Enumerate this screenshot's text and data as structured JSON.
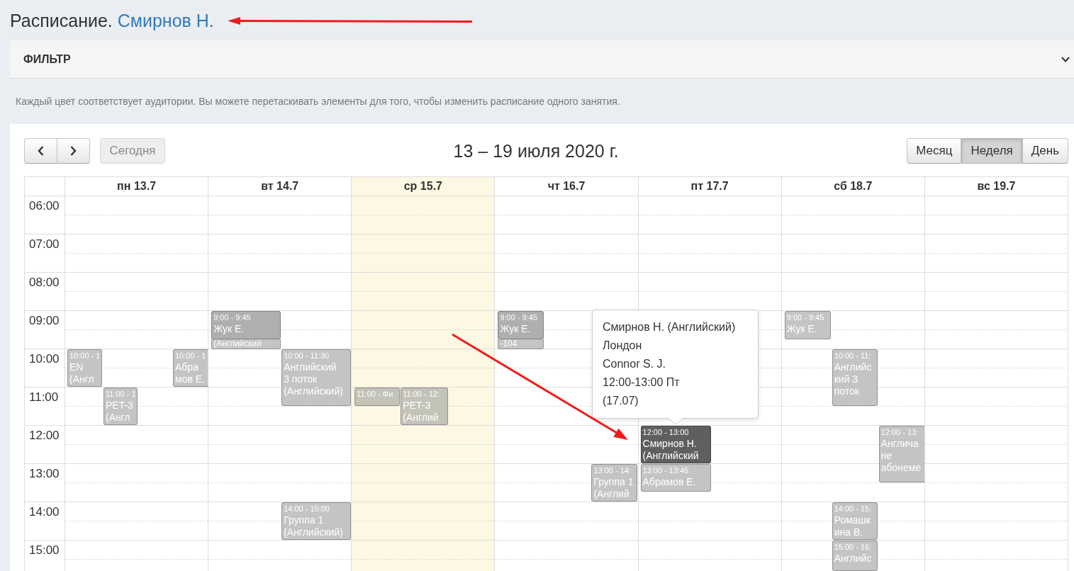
{
  "page": {
    "title": "Расписание.",
    "person": "Смирнов Н."
  },
  "filter": {
    "label": "ФИЛЬТР",
    "expanded": false
  },
  "hint": "Каждый цвет соответствует аудитории. Вы можете перетаскивать элементы для того, чтобы изменить расписание одного занятия.",
  "calendar": {
    "today_button": {
      "label": "Сегодня",
      "disabled": true
    },
    "title": "13 – 19 июля 2020 г.",
    "views": [
      {
        "label": "Месяц",
        "selected": false
      },
      {
        "label": "Неделя",
        "selected": true
      },
      {
        "label": "День",
        "selected": false
      }
    ],
    "days": [
      {
        "label": "пн 13.7",
        "today": false,
        "events": [
          {
            "time": "10:00 - 1",
            "lines": [
              "EN",
              "(Англ"
            ],
            "color": "#c4c4c4"
          },
          {
            "time": "11:00 - 1",
            "lines": [
              "PET-3",
              "(Англ"
            ],
            "color": "#c4c4c4"
          },
          {
            "time": "10:00 - 1",
            "lines": [
              "Абра",
              "мов Е."
            ],
            "color": "#c4c4c4"
          }
        ]
      },
      {
        "label": "вт 14.7",
        "today": false,
        "events": [
          {
            "time": "9:00 - 9:45",
            "lines": [
              "Жук Е."
            ],
            "color": "#afafaf"
          },
          {
            "lines": [
              "(Английский"
            ],
            "color": "#c4c4c4"
          },
          {
            "time": "10:00 - 11:30",
            "lines": [
              "Английский",
              "3 поток",
              "(Английский)"
            ],
            "color": "#c4c4c4"
          },
          {
            "time": "14:00 - 15:00",
            "lines": [
              "Группа 1",
              "(Английский)"
            ],
            "color": "#c4c4c4"
          }
        ]
      },
      {
        "label": "ср 15.7",
        "today": true,
        "events": [
          {
            "time": "11:00 - Фи",
            "color": "#c4c3b8"
          },
          {
            "time": "11:00 - 12:",
            "lines": [
              "PET-3",
              "(Англий"
            ],
            "color": "#c4c3b8"
          }
        ]
      },
      {
        "label": "чт 16.7",
        "today": false,
        "events": [
          {
            "time": "9:00 - 9:45",
            "lines": [
              "Жук Е."
            ],
            "color": "#afafaf"
          },
          {
            "lines": [
              "-104"
            ],
            "color": "#c4c4c4"
          },
          {
            "time": "13:00 - 14:",
            "lines": [
              "Группа 1",
              "(Англий"
            ],
            "color": "#c4c4c4"
          }
        ]
      },
      {
        "label": "пт 17.7",
        "today": false,
        "events": [
          {
            "time": "12:00 - 13:00",
            "lines": [
              "Смирнов Н.",
              "(Английский"
            ],
            "color": "#5f5f5f"
          },
          {
            "time": "13:00 - 13:45",
            "lines": [
              "Абрамов Е."
            ],
            "color": "#c4c4c4"
          }
        ]
      },
      {
        "label": "сб 18.7",
        "today": false,
        "events": [
          {
            "time": "9:00 - 9:45",
            "lines": [
              "Жук Е."
            ],
            "color": "#c4c4c4"
          },
          {
            "time": "10:00 - 11:",
            "lines": [
              "Английс",
              "кий 3",
              "поток"
            ],
            "color": "#c4c4c4"
          },
          {
            "time": "12:00 - 13:",
            "lines": [
              "Англича",
              "не",
              "абонеме"
            ],
            "color": "#c4c4c4"
          },
          {
            "time": "14:00 - 15:",
            "lines": [
              "Ромашк",
              "ина В."
            ],
            "color": "#c4c4c4"
          },
          {
            "time": "15:00 - 16:",
            "lines": [
              "Английс"
            ],
            "color": "#c4c4c4"
          }
        ]
      },
      {
        "label": "вс 19.7",
        "today": false
      }
    ],
    "times": [
      "06:00",
      "07:00",
      "08:00",
      "09:00",
      "10:00",
      "11:00",
      "12:00",
      "13:00",
      "14:00",
      "15:00"
    ]
  },
  "tooltip": {
    "lines": [
      "Смирнов Н. (Английский)",
      "Лондон",
      "Connor S. J.",
      "12:00-13:00 Пт",
      "(17.07)"
    ]
  }
}
